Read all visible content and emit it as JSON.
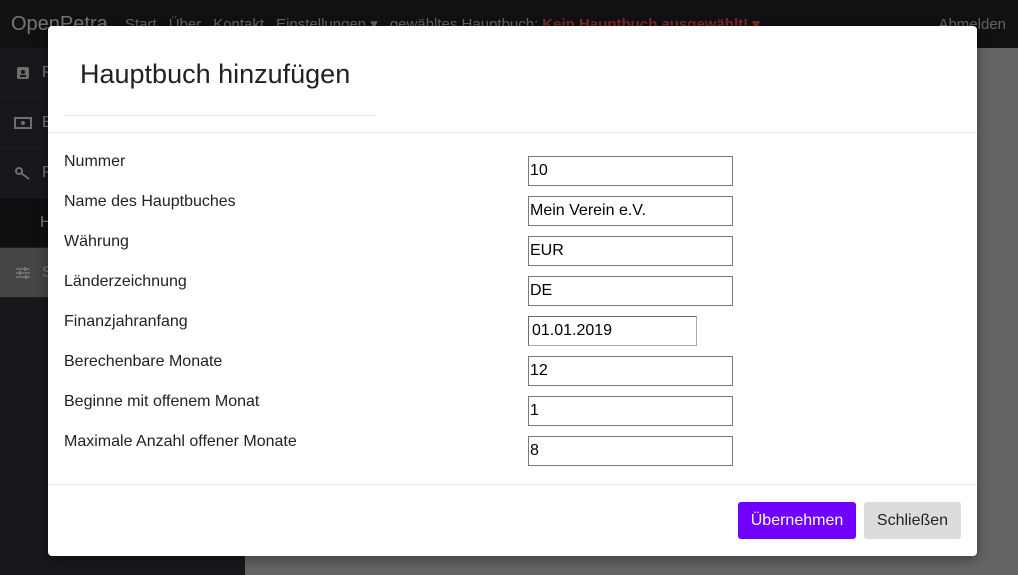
{
  "app": {
    "brand": "OpenPetra",
    "nav": [
      "Start",
      "Über",
      "Kontakt",
      "Einstellungen ▾"
    ],
    "ledger_label": "gewähltes Hauptbuch:",
    "ledger_value": "Kein Hauptbuch ausgewählt! ▾",
    "logout": "Abmelden"
  },
  "sidebar": {
    "items": [
      {
        "label": "P",
        "icon": "contact-card-icon"
      },
      {
        "label": "B",
        "icon": "money-icon"
      },
      {
        "label": "P",
        "icon": "key-icon"
      },
      {
        "label": "H",
        "icon": ""
      },
      {
        "label": "S",
        "icon": "sliders-icon"
      }
    ]
  },
  "modal": {
    "title": "Hauptbuch hinzufügen",
    "fields": [
      {
        "label": "Nummer",
        "value": "10"
      },
      {
        "label": "Name des Hauptbuches",
        "value": "Mein Verein e.V."
      },
      {
        "label": "Währung",
        "value": "EUR"
      },
      {
        "label": "Länderzeichnung",
        "value": "DE"
      },
      {
        "label": "Finanzjahranfang",
        "value": "01.01.2019"
      },
      {
        "label": "Berechenbare Monate",
        "value": "12"
      },
      {
        "label": "Beginne mit offenem Monat",
        "value": "1"
      },
      {
        "label": "Maximale Anzahl offener Monate",
        "value": "8"
      }
    ],
    "submit_label": "Übernehmen",
    "close_label": "Schließen"
  },
  "colors": {
    "primary": "#7000ff",
    "secondary": "#dcdcdc",
    "warning_text": "#ff4d4d"
  }
}
